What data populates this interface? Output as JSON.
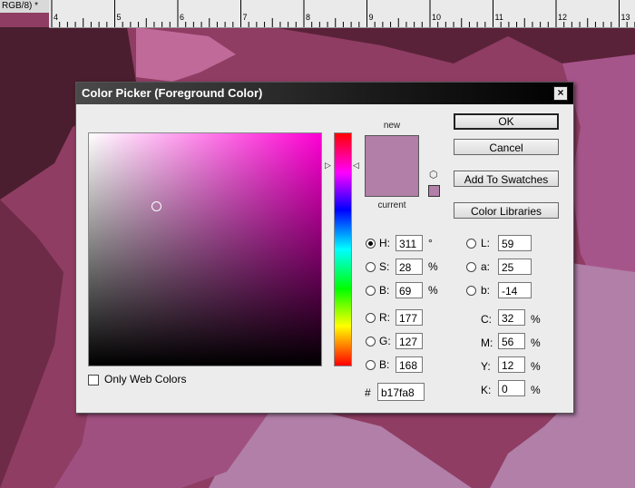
{
  "document_tab": {
    "label": "RGB/8) *",
    "close_glyph": "×"
  },
  "ruler": {
    "labels": [
      "4",
      "5",
      "6",
      "7",
      "8",
      "9",
      "10",
      "11",
      "12",
      "13"
    ]
  },
  "dialog": {
    "title": "Color Picker (Foreground Color)",
    "close_glyph": "×",
    "swatches": {
      "new_label": "new",
      "current_label": "current",
      "new_color": "#b17fa8",
      "current_color": "#b17fa8",
      "gamut_warning_icon": "cube-icon"
    },
    "buttons": {
      "ok": "OK",
      "cancel": "Cancel",
      "add_to_swatches": "Add To Swatches",
      "color_libraries": "Color Libraries"
    },
    "hsb": {
      "h": {
        "label": "H:",
        "value": "311",
        "unit": "°"
      },
      "s": {
        "label": "S:",
        "value": "28",
        "unit": "%"
      },
      "b": {
        "label": "B:",
        "value": "69",
        "unit": "%"
      }
    },
    "rgb": {
      "r": {
        "label": "R:",
        "value": "177"
      },
      "g": {
        "label": "G:",
        "value": "127"
      },
      "b": {
        "label": "B:",
        "value": "168"
      }
    },
    "lab": {
      "l": {
        "label": "L:",
        "value": "59"
      },
      "a": {
        "label": "a:",
        "value": "25"
      },
      "b": {
        "label": "b:",
        "value": "-14"
      }
    },
    "cmyk": {
      "c": {
        "label": "C:",
        "value": "32",
        "unit": "%"
      },
      "m": {
        "label": "M:",
        "value": "56",
        "unit": "%"
      },
      "y": {
        "label": "Y:",
        "value": "12",
        "unit": "%"
      },
      "k": {
        "label": "K:",
        "value": "0",
        "unit": "%"
      }
    },
    "hex": {
      "label": "#",
      "value": "b17fa8"
    },
    "only_web_colors": {
      "label": "Only Web Colors",
      "checked": false
    },
    "selected_mode": "H",
    "hue_color": "#ff00d4"
  },
  "colors": {
    "bg_dark": "#5a2238",
    "bg_mid": "#8f3d63",
    "bg_light": "#b17fa8"
  }
}
